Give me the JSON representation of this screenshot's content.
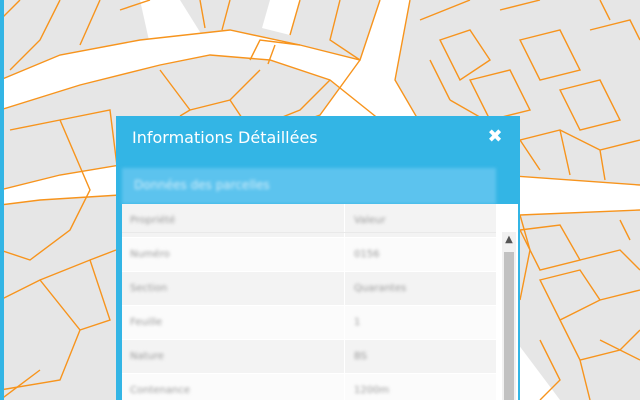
{
  "modal": {
    "title": "Informations Détaillées",
    "section_heading": "Données des parcelles",
    "rows": [
      {
        "key": "Propriété",
        "value": "Valeur"
      },
      {
        "key": "Numéro",
        "value": "0156"
      },
      {
        "key": "Section",
        "value": "Quarantes"
      },
      {
        "key": "Feuille",
        "value": "1"
      },
      {
        "key": "Nature",
        "value": "BS"
      },
      {
        "key": "Contenance",
        "value": "1200m"
      }
    ]
  },
  "icons": {
    "close": "close-icon",
    "scroll_up": "chevron-up-icon"
  },
  "colors": {
    "accent": "#33b5e5",
    "map_lines": "#f7941d",
    "map_fill": "#e6e6e6",
    "roads": "#ffffff"
  }
}
